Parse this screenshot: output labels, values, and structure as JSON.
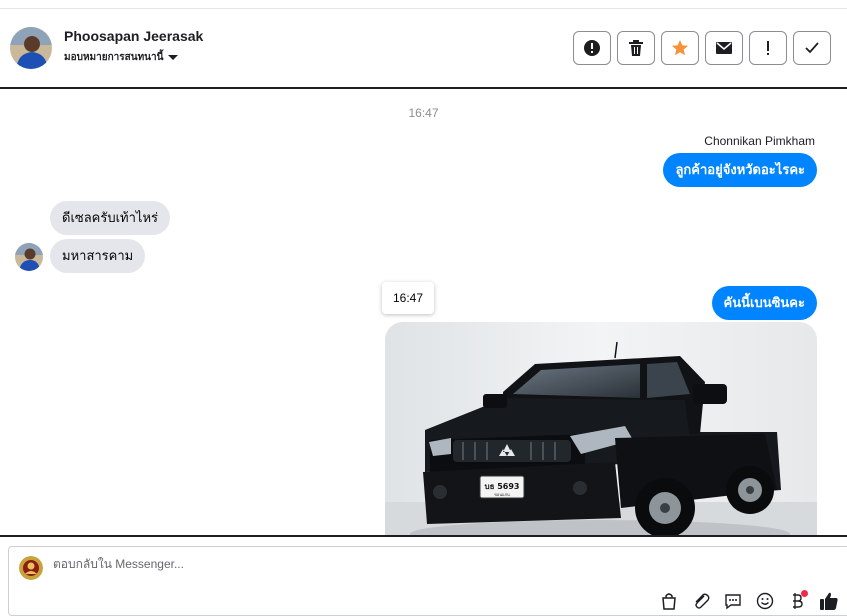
{
  "header": {
    "contact_name": "Phoosapan Jeerasak",
    "assign_label": "มอบหมายการสนทนานี้",
    "actions": [
      {
        "icon": "alert-circle-icon",
        "label": "Mark as spam"
      },
      {
        "icon": "trash-icon",
        "label": "Delete"
      },
      {
        "icon": "star-icon",
        "label": "Star"
      },
      {
        "icon": "envelope-icon",
        "label": "Mark as unread"
      },
      {
        "icon": "exclamation-icon",
        "label": "Follow up"
      },
      {
        "icon": "check-icon",
        "label": "Mark as done"
      }
    ]
  },
  "conversation": {
    "timestamp": "16:47",
    "agent_name": "Chonnikan Pimkham",
    "messages": [
      {
        "direction": "outgoing",
        "text": "ลูกค้าอยู่จังหวัดอะไรคะ"
      },
      {
        "direction": "incoming",
        "text": "ดีเซลครับเท้าไหร่"
      },
      {
        "direction": "incoming",
        "text": "มหาสารคาม"
      },
      {
        "direction": "outgoing",
        "text": "คันนี้เบนซินคะ"
      }
    ],
    "hover_timestamp": "16:47",
    "attachment": {
      "type": "photo",
      "subject": "black pickup truck",
      "plate": "บธ 5693",
      "province": "ขอนแก่น"
    }
  },
  "composer": {
    "placeholder": "ตอบกลับใน Messenger...",
    "tools": [
      "shopping-bag-icon",
      "paperclip-icon",
      "saved-reply-icon",
      "emoji-icon",
      "baht-payment-icon",
      "thumbs-up-icon"
    ]
  },
  "colors": {
    "accent": "#0084ff",
    "incoming_bubble": "#e4e6eb",
    "star": "#f7923a",
    "notification": "#f02849"
  }
}
